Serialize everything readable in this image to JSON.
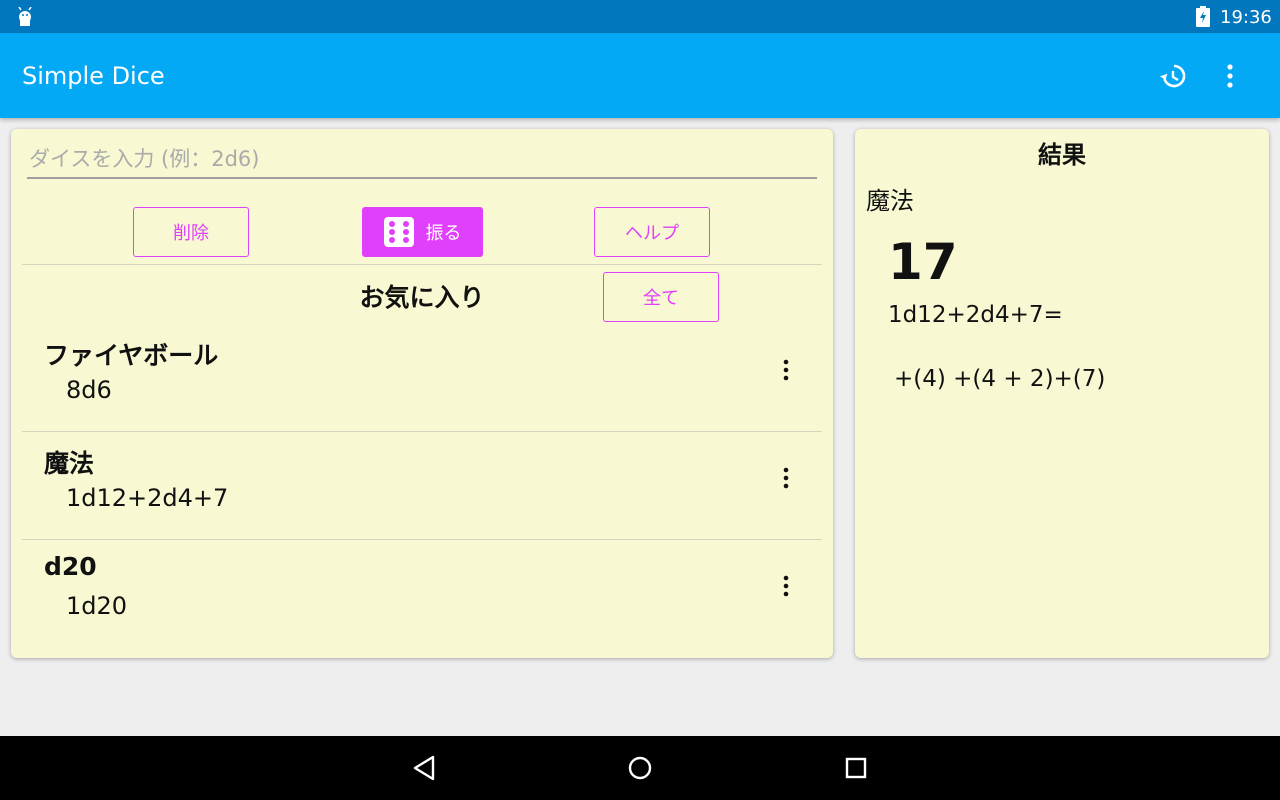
{
  "status_bar": {
    "time": "19:36"
  },
  "app_bar": {
    "title": "Simple Dice"
  },
  "input": {
    "placeholder": "ダイスを入力 (例：2d6)",
    "value": ""
  },
  "buttons": {
    "delete": "削除",
    "roll": "振る",
    "help": "ヘルプ",
    "all": "全て"
  },
  "favorites": {
    "title": "お気に入り",
    "items": [
      {
        "name": "ファイヤボール",
        "formula": "8d6"
      },
      {
        "name": "魔法",
        "formula": "1d12+2d4+7"
      },
      {
        "name": "d20",
        "formula": "1d20"
      }
    ]
  },
  "result": {
    "heading": "結果",
    "name": "魔法",
    "total": "17",
    "formula": "1d12+2d4+7=",
    "breakdown": "+(4) +(4 + 2)+(7)"
  },
  "colors": {
    "accent": "#e040fb",
    "app_bar": "#03a9f4",
    "status_bar": "#0277bd",
    "card": "#f8f8d2"
  },
  "icons": {
    "status": [
      "android-icon",
      "battery-charging-icon"
    ],
    "app_bar": [
      "history-icon",
      "overflow-menu-icon"
    ],
    "nav": [
      "nav-back-icon",
      "nav-home-icon",
      "nav-recent-icon"
    ]
  }
}
